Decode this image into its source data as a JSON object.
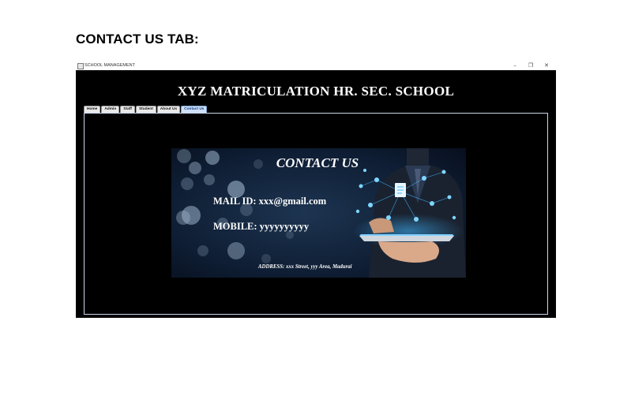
{
  "document": {
    "heading": "CONTACT US TAB:"
  },
  "window": {
    "title": "SCHOOL MANAGEMENT",
    "controls": {
      "minimize": "–",
      "maximize": "❐",
      "close": "✕"
    }
  },
  "app": {
    "school_name": "XYZ MATRICULATION HR. SEC. SCHOOL",
    "tabs": [
      {
        "label": "Home"
      },
      {
        "label": "Admin"
      },
      {
        "label": "Staff"
      },
      {
        "label": "Student"
      },
      {
        "label": "About Us"
      },
      {
        "label": "Contact Us",
        "active": true
      }
    ]
  },
  "contact": {
    "title": "CONTACT US",
    "mail": "MAIL ID: xxx@gmail.com",
    "mobile": "MOBILE: yyyyyyyyyy",
    "address": "ADDRESS: xxx Street, yyy Area, Madurai"
  },
  "colors": {
    "window_bg": "#000000",
    "active_tab": "#cfe0f5",
    "banner_glow": "#3fb6ff"
  }
}
